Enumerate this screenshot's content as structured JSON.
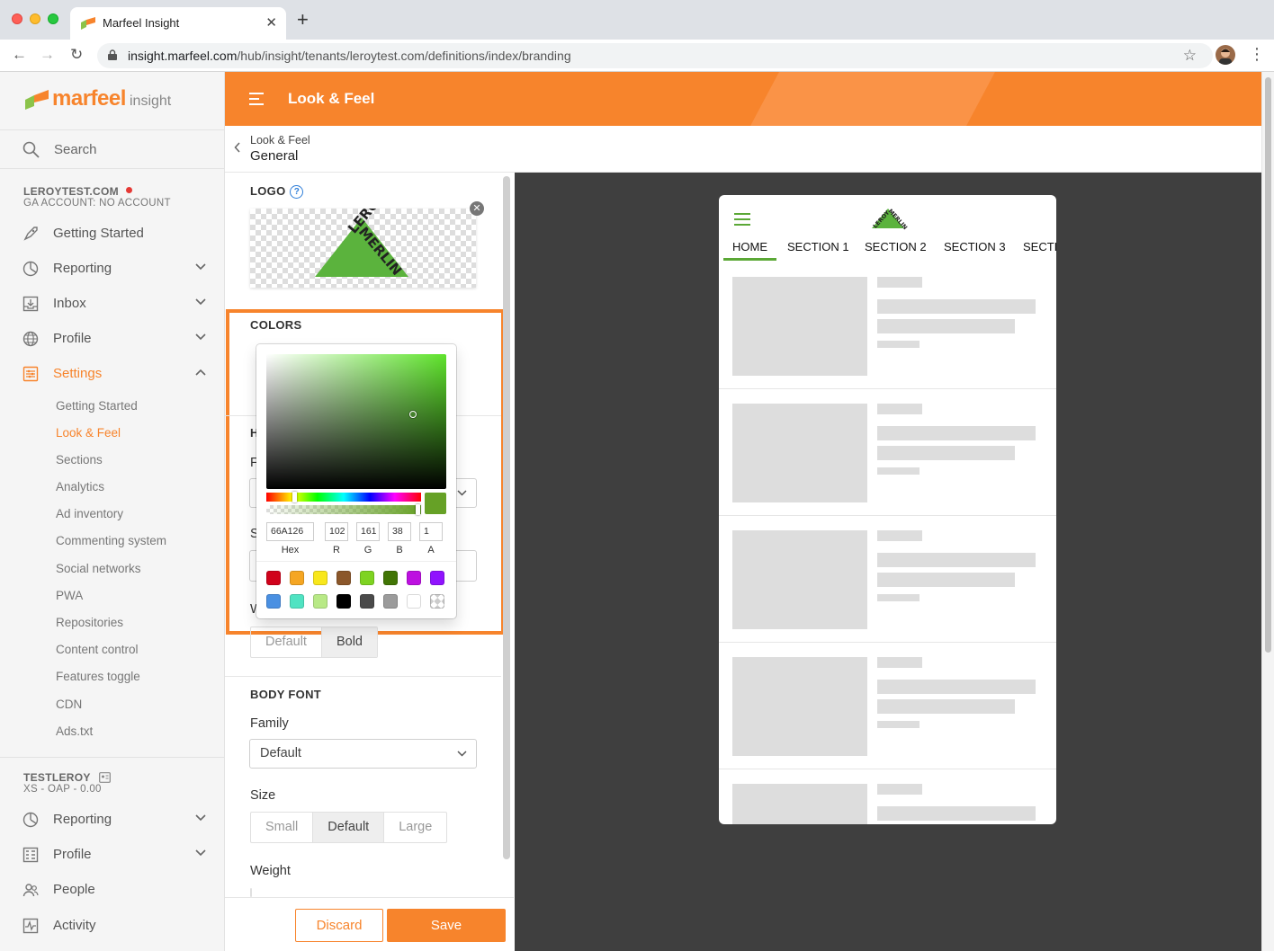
{
  "browser": {
    "tab_title": "Marfeel Insight",
    "url_host": "insight.marfeel.com",
    "url_path": "/hub/insight/tenants/leroytest.com/definitions/index/branding"
  },
  "sidebar": {
    "brand": "marfeel",
    "brand_sub": "insight",
    "search_label": "Search",
    "account": {
      "name": "LEROYTEST.COM",
      "sub": "GA ACCOUNT: NO ACCOUNT"
    },
    "items": [
      {
        "label": "Getting Started",
        "icon": "rocket-icon"
      },
      {
        "label": "Reporting",
        "icon": "pie-chart-icon"
      },
      {
        "label": "Inbox",
        "icon": "inbox-icon"
      },
      {
        "label": "Profile",
        "icon": "globe-icon"
      },
      {
        "label": "Settings",
        "icon": "settings-icon"
      }
    ],
    "settings_children": [
      "Getting Started",
      "Look & Feel",
      "Sections",
      "Analytics",
      "Ad inventory",
      "Commenting system",
      "Social networks",
      "PWA",
      "Repositories",
      "Content control",
      "Features toggle",
      "CDN",
      "Ads.txt"
    ],
    "active_child": "Look & Feel",
    "tenant": {
      "name": "TESTLEROY",
      "sub": "XS - OAP - 0.00"
    },
    "tenant_items": [
      {
        "label": "Reporting",
        "icon": "pie-chart-icon"
      },
      {
        "label": "Profile",
        "icon": "grid-icon"
      },
      {
        "label": "People",
        "icon": "people-icon"
      },
      {
        "label": "Activity",
        "icon": "activity-icon"
      }
    ]
  },
  "header": {
    "title": "Look & Feel"
  },
  "breadcrumb": {
    "parent": "Look & Feel",
    "current": "General"
  },
  "panel": {
    "logo_title": "LOGO",
    "colors_title": "COLORS",
    "heading_weight_options": [
      "Default",
      "Bold"
    ],
    "heading_weight_selected": "Bold",
    "body_font_title": "BODY FONT",
    "family_label": "Family",
    "family_value": "Default",
    "size_label": "Size",
    "size_options": [
      "Small",
      "Default",
      "Large"
    ],
    "size_selected": "Default",
    "weight_label": "Weight",
    "discard": "Discard",
    "save": "Save"
  },
  "color_picker": {
    "hex": "66A126",
    "r": "102",
    "g": "161",
    "b": "38",
    "a": "1",
    "labels": {
      "hex": "Hex",
      "r": "R",
      "g": "G",
      "b": "B",
      "a": "A"
    },
    "current_color": "#66a126",
    "presets": [
      "#d0021b",
      "#f5a623",
      "#f8e71c",
      "#8b572a",
      "#7ed321",
      "#417505",
      "#bd10e0",
      "#9013fe",
      "#4a90e2",
      "#50e3c2",
      "#b8e986",
      "#000000",
      "#4a4a4a",
      "#9b9b9b",
      "#ffffff",
      "transparent"
    ]
  },
  "preview": {
    "nav": [
      "HOME",
      "SECTION 1",
      "SECTION 2",
      "SECTION 3",
      "SECTI"
    ],
    "accent": "#5ba836"
  },
  "colors": {
    "brand": "#f7842c",
    "preview_bg": "#3f3f3f"
  }
}
